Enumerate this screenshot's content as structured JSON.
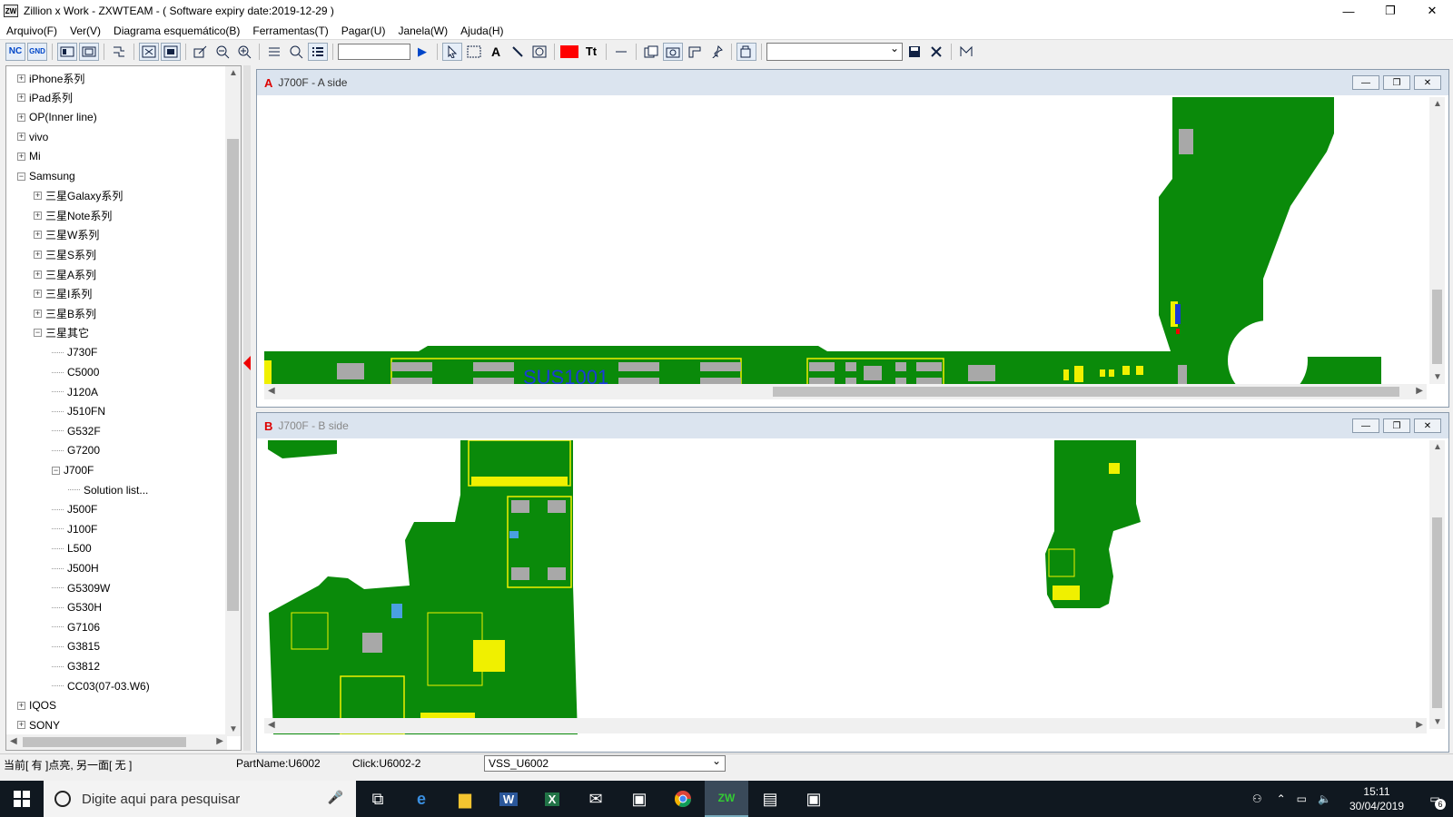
{
  "window": {
    "title": "Zillion x Work - ZXWTEAM - ( Software expiry date:2019-12-29 )",
    "icon_text": "ZW",
    "minimize": "—",
    "maximize": "❐",
    "close": "✕"
  },
  "menu": [
    "Arquivo(F)",
    "Ver(V)",
    "Diagrama esquemático(B)",
    "Ferramentas(T)",
    "Pagar(U)",
    "Janela(W)",
    "Ajuda(H)"
  ],
  "toolbar": {
    "nc_label": "NC",
    "gnd_label": "GND",
    "text_tool": "A",
    "tt_tool": "Tt",
    "play": "▶",
    "accent_red": "#ff0000"
  },
  "tree": {
    "items": [
      {
        "label": "iPhone系列",
        "level": 0,
        "state": "collapsed"
      },
      {
        "label": "iPad系列",
        "level": 0,
        "state": "collapsed"
      },
      {
        "label": "OP(Inner line)",
        "level": 0,
        "state": "collapsed"
      },
      {
        "label": "vivo",
        "level": 0,
        "state": "collapsed"
      },
      {
        "label": "Mi",
        "level": 0,
        "state": "collapsed"
      },
      {
        "label": "Samsung",
        "level": 0,
        "state": "expanded"
      },
      {
        "label": "三星Galaxy系列",
        "level": 1,
        "state": "collapsed"
      },
      {
        "label": "三星Note系列",
        "level": 1,
        "state": "collapsed"
      },
      {
        "label": "三星W系列",
        "level": 1,
        "state": "collapsed"
      },
      {
        "label": "三星S系列",
        "level": 1,
        "state": "collapsed"
      },
      {
        "label": "三星A系列",
        "level": 1,
        "state": "collapsed"
      },
      {
        "label": "三星I系列",
        "level": 1,
        "state": "collapsed"
      },
      {
        "label": "三星B系列",
        "level": 1,
        "state": "collapsed"
      },
      {
        "label": "三星其它",
        "level": 1,
        "state": "expanded"
      },
      {
        "label": "J730F",
        "level": 2,
        "state": "leaf"
      },
      {
        "label": "C5000",
        "level": 2,
        "state": "leaf"
      },
      {
        "label": "J120A",
        "level": 2,
        "state": "leaf"
      },
      {
        "label": "J510FN",
        "level": 2,
        "state": "leaf"
      },
      {
        "label": "G532F",
        "level": 2,
        "state": "leaf"
      },
      {
        "label": "G7200",
        "level": 2,
        "state": "leaf"
      },
      {
        "label": "J700F",
        "level": 2,
        "state": "expanded"
      },
      {
        "label": "Solution list...",
        "level": 3,
        "state": "leaf"
      },
      {
        "label": "J500F",
        "level": 2,
        "state": "leaf"
      },
      {
        "label": "J100F",
        "level": 2,
        "state": "leaf"
      },
      {
        "label": "L500",
        "level": 2,
        "state": "leaf"
      },
      {
        "label": "J500H",
        "level": 2,
        "state": "leaf"
      },
      {
        "label": "G5309W",
        "level": 2,
        "state": "leaf"
      },
      {
        "label": "G530H",
        "level": 2,
        "state": "leaf"
      },
      {
        "label": "G7106",
        "level": 2,
        "state": "leaf"
      },
      {
        "label": "G3815",
        "level": 2,
        "state": "leaf"
      },
      {
        "label": "G3812",
        "level": 2,
        "state": "leaf"
      },
      {
        "label": "CC03(07-03.W6)",
        "level": 2,
        "state": "leaf"
      },
      {
        "label": "IQOS",
        "level": 0,
        "state": "collapsed"
      },
      {
        "label": "SONY",
        "level": 0,
        "state": "collapsed"
      }
    ]
  },
  "panels": {
    "a": {
      "letter": "A",
      "caption": "J700F - A side",
      "component_label": "SUS1001"
    },
    "b": {
      "letter": "B",
      "caption": "J700F - B side"
    }
  },
  "colors": {
    "pcb_green": "#0a8a0a",
    "pad_yellow": "#f0f000",
    "pad_gray": "#a8a8a8",
    "label_blue": "#1a3ad8"
  },
  "statusbar": {
    "info": "当前[ 有 ]点亮, 另一面[ 无 ]",
    "part_name": "PartName:U6002",
    "click": "Click:U6002-2",
    "net": "VSS_U6002"
  },
  "taskbar": {
    "search_placeholder": "Digite aqui para pesquisar",
    "time": "15:11",
    "date": "30/04/2019",
    "notifications": "6"
  }
}
